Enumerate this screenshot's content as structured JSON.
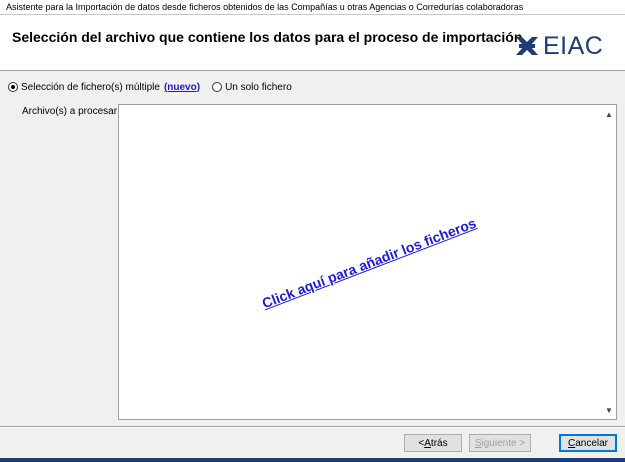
{
  "window": {
    "title": "Asistente para la Importación de datos desde ficheros obtenidos de las Compañías u otras Agencias o Corredurías colaboradoras"
  },
  "header": {
    "title": "Selección del archivo que contiene los datos para el proceso de importación",
    "logo_text": "EIAC"
  },
  "options": {
    "multiple_label": "Selección de fichero(s) múltiple",
    "nuevo_label": "(nuevo)",
    "single_label": "Un solo fichero",
    "selected": "multiple"
  },
  "files": {
    "label": "Archivo(s) a procesar",
    "drop_link": "Click aquí para añadir los ficheros"
  },
  "buttons": {
    "back_prefix": "< ",
    "back_key": "A",
    "back_rest": "trás",
    "next_key": "S",
    "next_rest": "iguiente >",
    "cancel_key": "C",
    "cancel_rest": "ancelar"
  },
  "colors": {
    "link": "#1a1ad8",
    "brand": "#1e3c78"
  }
}
